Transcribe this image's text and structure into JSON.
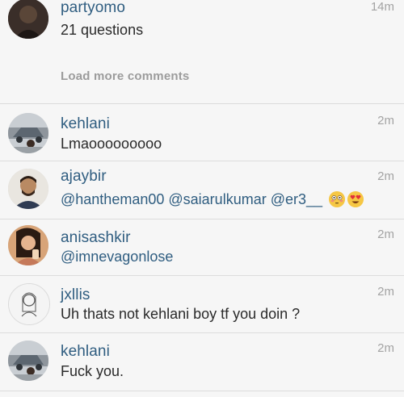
{
  "comments_top": {
    "username": "partyomo",
    "text": "21 questions",
    "time": "14m"
  },
  "load_more": "Load more comments",
  "comments": [
    {
      "username": "kehlani",
      "text": "Lmaooooooooo",
      "time": "2m"
    },
    {
      "username": "ajaybir",
      "mentions": [
        "@hantheman00",
        "@saiarulkumar",
        "@er3__"
      ],
      "time": "2m",
      "emojis": [
        "flushed-face-emoji",
        "heart-eyes-emoji"
      ]
    },
    {
      "username": "anisashkir",
      "mentions": [
        "@imnevagonlose"
      ],
      "time": "2m"
    },
    {
      "username": "jxllis",
      "text": "Uh thats not kehlani boy tf you doin ?",
      "time": "2m"
    },
    {
      "username": "kehlani",
      "text": "Fuck you.",
      "time": "2m"
    }
  ]
}
